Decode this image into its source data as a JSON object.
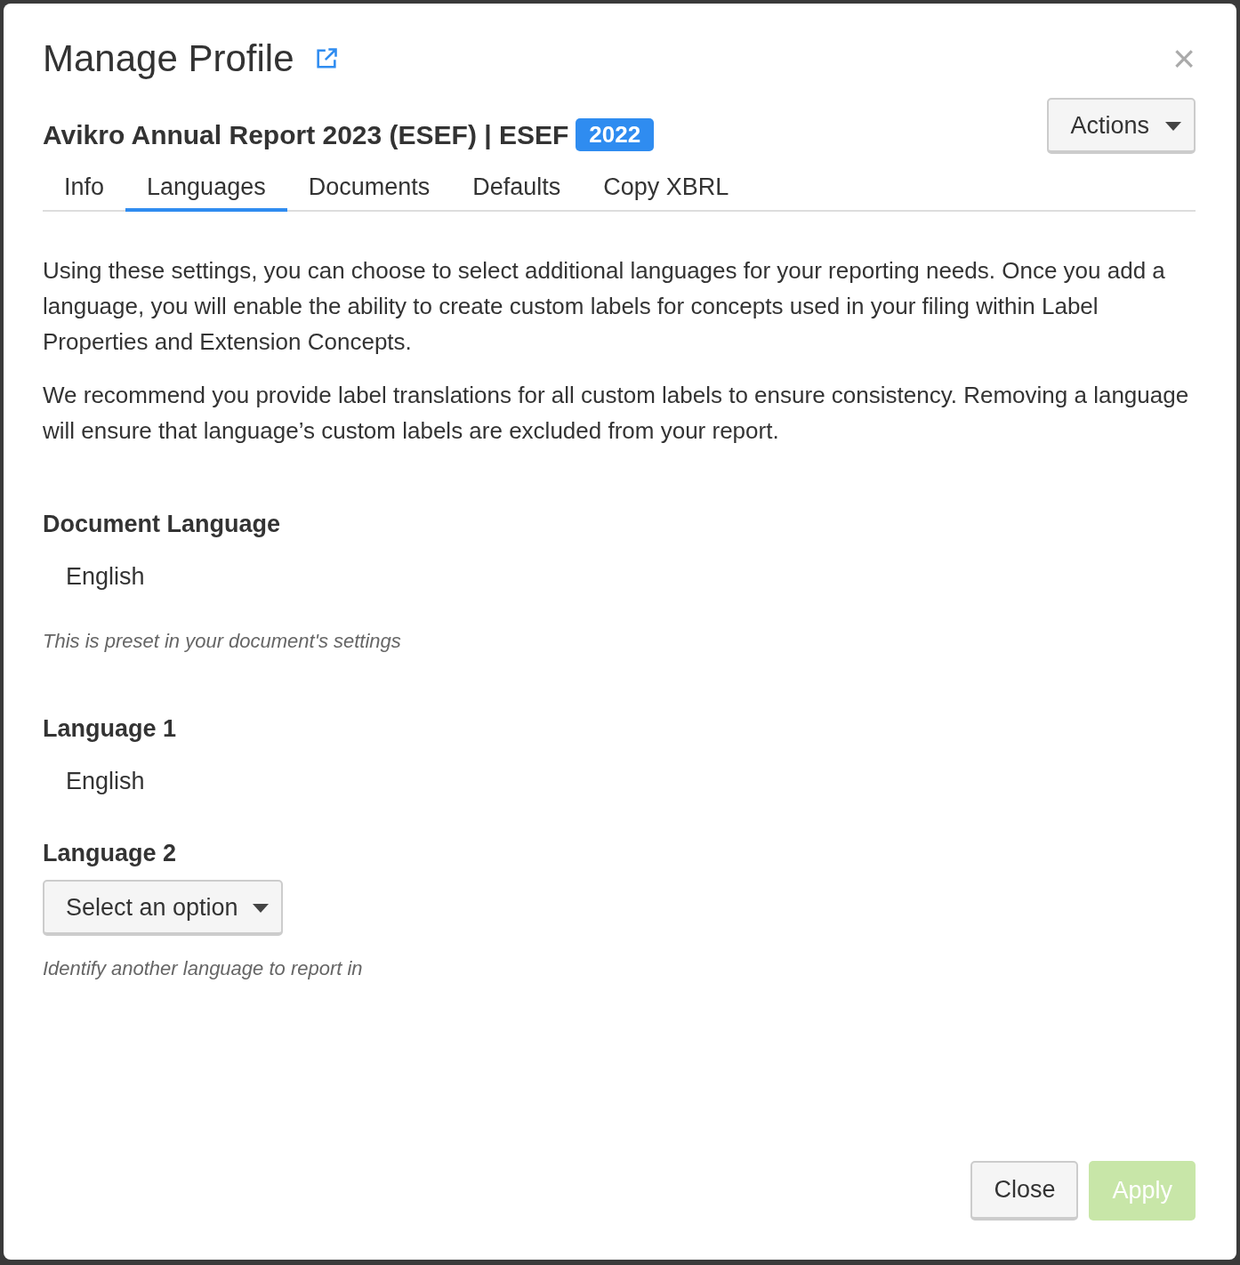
{
  "dialog": {
    "title": "Manage Profile",
    "close_icon": "×"
  },
  "profile": {
    "name": "Avikro Annual Report 2023 (ESEF) | ESEF",
    "badge": "2022",
    "actions_button": "Actions"
  },
  "tabs": [
    {
      "label": "Info",
      "selected": false
    },
    {
      "label": "Languages",
      "selected": true
    },
    {
      "label": "Documents",
      "selected": false
    },
    {
      "label": "Defaults",
      "selected": false
    },
    {
      "label": "Copy XBRL",
      "selected": false
    }
  ],
  "paragraphs": [
    "Using these settings, you can choose to select additional languages for your reporting needs. Once you add a language, you will enable the ability to create custom labels for concepts used in your filing within Label Properties and Extension Concepts.",
    "We recommend you provide label translations for all custom labels to ensure consistency. Removing a language will ensure that language’s custom labels are excluded from your report."
  ],
  "fields": [
    {
      "kind": "static",
      "label": "Document Language",
      "value": "English",
      "hint": "This is preset in your document's settings"
    },
    {
      "kind": "static",
      "label": "Language 1",
      "value": "English"
    },
    {
      "kind": "select",
      "label": "Language 2",
      "placeholder": "Select an option",
      "hint": "Identify another language to report in"
    }
  ],
  "footer": {
    "buttons": [
      {
        "label": "Close",
        "kind": "secondary",
        "disabled": false
      },
      {
        "label": "Apply",
        "kind": "primary",
        "disabled": true
      }
    ]
  }
}
